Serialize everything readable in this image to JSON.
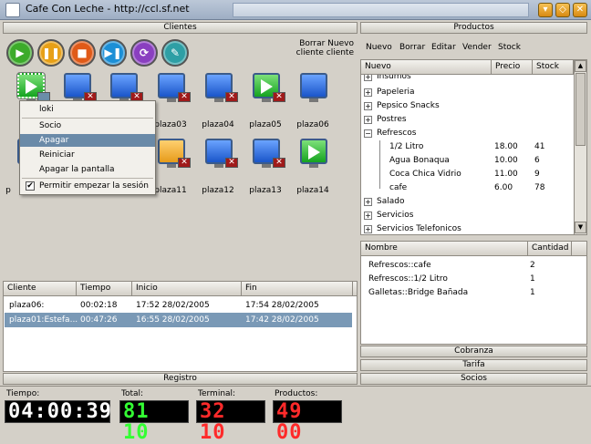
{
  "window": {
    "title": "Cafe Con Leche - http://ccl.sf.net"
  },
  "clientes": {
    "header": "Clientes",
    "toolbar_hint": [
      "Borrar Nuevo",
      "cliente cliente"
    ],
    "buttons": [
      "play",
      "pause",
      "stop",
      "skip",
      "sync",
      "edit"
    ],
    "clients": [
      {
        "label": "",
        "state": "selected-green"
      },
      {
        "label": "",
        "state": "blue-x"
      },
      {
        "label": "",
        "state": "blue-x"
      },
      {
        "label": "plaza03",
        "state": "blue-x"
      },
      {
        "label": "plaza04",
        "state": "blue-x"
      },
      {
        "label": "plaza05",
        "state": "green"
      },
      {
        "label": "plaza06",
        "state": "blue"
      },
      {
        "label": "p",
        "state": "blue"
      },
      {
        "label": "",
        "state": "blue"
      },
      {
        "label": "",
        "state": "orange"
      },
      {
        "label": "plaza11",
        "state": "orange-x"
      },
      {
        "label": "plaza12",
        "state": "blue-x"
      },
      {
        "label": "plaza13",
        "state": "blue-x"
      },
      {
        "label": "plaza14",
        "state": "green"
      }
    ],
    "context_menu": {
      "items": [
        "loki",
        "Socio",
        "Apagar",
        "Reiniciar",
        "Apagar la pantalla",
        "Permitir empezar la sesión"
      ],
      "selected_index": 2,
      "checked_item": "Permitir empezar la sesión"
    }
  },
  "sessions": {
    "columns": [
      "Cliente",
      "Tiempo",
      "Inicio",
      "Fin"
    ],
    "rows": [
      {
        "cliente": "plaza06:",
        "tiempo": "00:02:18",
        "inicio": "17:52  28/02/2005",
        "fin": "17:54  28/02/2005"
      },
      {
        "cliente": "plaza01:Estefa...",
        "tiempo": "00:47:26",
        "inicio": "16:55  28/02/2005",
        "fin": "17:42  28/02/2005"
      }
    ]
  },
  "registro": {
    "label": "Registro"
  },
  "productos": {
    "header": "Productos",
    "menu": [
      "Nuevo",
      "Borrar",
      "Editar",
      "Vender",
      "Stock"
    ],
    "columns": [
      "Nuevo",
      "Precio",
      "Stock"
    ],
    "tree": [
      {
        "name": "Insumos",
        "level": 0,
        "expander": "+",
        "precio": "",
        "stock": ""
      },
      {
        "name": "Papeleria",
        "level": 0,
        "expander": "+",
        "precio": "",
        "stock": ""
      },
      {
        "name": "Pepsico Snacks",
        "level": 0,
        "expander": "+",
        "precio": "",
        "stock": ""
      },
      {
        "name": "Postres",
        "level": 0,
        "expander": "+",
        "precio": "",
        "stock": ""
      },
      {
        "name": "Refrescos",
        "level": 0,
        "expander": "−",
        "precio": "",
        "stock": ""
      },
      {
        "name": "1/2 Litro",
        "level": 1,
        "expander": "",
        "precio": "18.00",
        "stock": "41"
      },
      {
        "name": "Agua Bonaqua",
        "level": 1,
        "expander": "",
        "precio": "10.00",
        "stock": "6"
      },
      {
        "name": "Coca Chica Vidrio",
        "level": 1,
        "expander": "",
        "precio": "11.00",
        "stock": "9"
      },
      {
        "name": "cafe",
        "level": 1,
        "expander": "",
        "precio": "6.00",
        "stock": "78"
      },
      {
        "name": "Salado",
        "level": 0,
        "expander": "+",
        "precio": "",
        "stock": ""
      },
      {
        "name": "Servicios",
        "level": 0,
        "expander": "+",
        "precio": "",
        "stock": ""
      },
      {
        "name": "Servicios Telefonicos",
        "level": 0,
        "expander": "+",
        "precio": "",
        "stock": ""
      }
    ]
  },
  "ventas": {
    "columns": [
      "Nombre",
      "Cantidad"
    ],
    "rows": [
      {
        "nombre": "Refrescos::cafe",
        "cantidad": "2"
      },
      {
        "nombre": "Refrescos::1/2 Litro",
        "cantidad": "1"
      },
      {
        "nombre": "Galletas::Bridge Bañada",
        "cantidad": "1"
      }
    ]
  },
  "side_tabs": [
    "Cobranza",
    "Tarifa",
    "Socios"
  ],
  "status": {
    "tiempo": {
      "caption": "Tiempo:",
      "value": "04:00:39",
      "color": "#ffffff"
    },
    "total": {
      "caption": "Total:",
      "value": "81 10",
      "color": "#33ff33"
    },
    "terminal": {
      "caption": "Terminal:",
      "value": "32 10",
      "color": "#ff2a2a"
    },
    "productos": {
      "caption": "Productos:",
      "value": "49 00",
      "color": "#ff2a2a"
    }
  }
}
